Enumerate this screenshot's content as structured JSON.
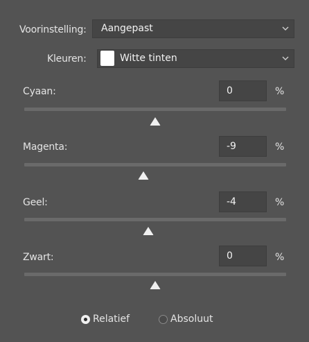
{
  "preset": {
    "label": "Voorinstelling:",
    "value": "Aangepast"
  },
  "colors": {
    "label": "Kleuren:",
    "value": "Witte tinten",
    "swatch_color": "#ffffff"
  },
  "sliders": [
    {
      "label": "Cyaan:",
      "value": "0",
      "unit": "%"
    },
    {
      "label": "Magenta:",
      "value": "-9",
      "unit": "%"
    },
    {
      "label": "Geel:",
      "value": "-4",
      "unit": "%"
    },
    {
      "label": "Zwart:",
      "value": "0",
      "unit": "%"
    }
  ],
  "mode": {
    "relative_label": "Relatief",
    "absolute_label": "Absoluut",
    "selected": "relative"
  },
  "icons": {
    "dropdown": "chevron-down-icon",
    "slider_thumb": "triangle-thumb-icon"
  },
  "theme": {
    "panel_bg": "#535353",
    "field_bg": "#454545",
    "text": "#e4e4e4"
  }
}
